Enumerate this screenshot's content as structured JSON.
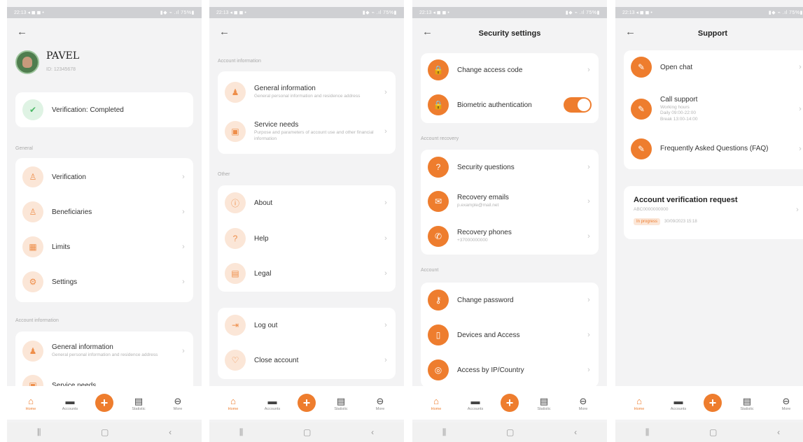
{
  "status_bar": {
    "time": "22:13 ◂ ◼ ◼ •",
    "icons": "▮◆ ⌁ .ıl 75%▮"
  },
  "bottom_nav": {
    "home": "Home",
    "accounts": "Accounts",
    "add": "+",
    "statistic": "Statistic",
    "more": "More",
    "home_icon": "⌂",
    "accounts_icon": "▬",
    "statistic_icon": "▤",
    "more_icon": "⊖"
  },
  "system_nav": {
    "recent": "⫼",
    "home": "▢",
    "back": "‹"
  },
  "screen1": {
    "user_name": "PAVEL",
    "user_id": "ID: 12345678",
    "verification_status": "Verification: Completed",
    "section_general": "General",
    "general_items": [
      {
        "label": "Verification",
        "icon": "person-icon",
        "glyph": "♙"
      },
      {
        "label": "Beneficiaries",
        "icon": "people-icon",
        "glyph": "♙"
      },
      {
        "label": "Limits",
        "icon": "limits-icon",
        "glyph": "▦"
      },
      {
        "label": "Settings",
        "icon": "gear-icon",
        "glyph": "⚙"
      }
    ],
    "section_account": "Account information",
    "account_items": [
      {
        "label": "General information",
        "sub": "General personal information and residence address",
        "glyph": "♟"
      },
      {
        "label": "Service needs",
        "sub": "",
        "glyph": "▣"
      }
    ]
  },
  "screen2": {
    "section_account": "Account information",
    "account_items": [
      {
        "label": "General information",
        "sub": "General personal information and residence address",
        "glyph": "♟"
      },
      {
        "label": "Service needs",
        "sub": "Purpose and parameters of account use and other financial information",
        "glyph": "▣"
      }
    ],
    "section_other": "Other",
    "other_items": [
      {
        "label": "About",
        "glyph": "ⓘ"
      },
      {
        "label": "Help",
        "glyph": "?"
      },
      {
        "label": "Legal",
        "glyph": "▤"
      }
    ],
    "logout_items": [
      {
        "label": "Log out",
        "glyph": "⇥"
      },
      {
        "label": "Close account",
        "glyph": "♡"
      }
    ]
  },
  "screen3": {
    "title": "Security settings",
    "security_items": [
      {
        "label": "Change access code",
        "glyph": "🔒"
      },
      {
        "label": "Biometric authentication",
        "glyph": "🔒"
      }
    ],
    "section_recovery": "Account recovery",
    "recovery_items": [
      {
        "label": "Security questions",
        "sub": "",
        "glyph": "?"
      },
      {
        "label": "Recovery emails",
        "sub": "p.example@mail.net",
        "glyph": "✉"
      },
      {
        "label": "Recovery phones",
        "sub": "+37000000000",
        "glyph": "✆"
      }
    ],
    "section_account": "Account",
    "account_items": [
      {
        "label": "Change password",
        "glyph": "⚷"
      },
      {
        "label": "Devices and Access",
        "glyph": "▯"
      },
      {
        "label": "Access by IP/Country",
        "glyph": "◎"
      }
    ]
  },
  "screen4": {
    "title": "Support",
    "support_items": [
      {
        "label": "Open chat",
        "sub": "",
        "glyph": "✎"
      },
      {
        "label": "Call support",
        "sub": "Working hours\nDaily 09:00-22:00\nBreak 13:00-14:00",
        "glyph": "✎"
      },
      {
        "label": "Frequently Asked Questions (FAQ)",
        "sub": "",
        "glyph": "✎"
      }
    ],
    "request_title": "Account verification request",
    "request_id": "ABC0000000000",
    "request_status": "In progress",
    "request_date": "30/09/2023 15:18"
  },
  "colors": {
    "accent": "#ee7d2e",
    "accent_soft": "#fbe6d7",
    "success": "#4bb865"
  }
}
